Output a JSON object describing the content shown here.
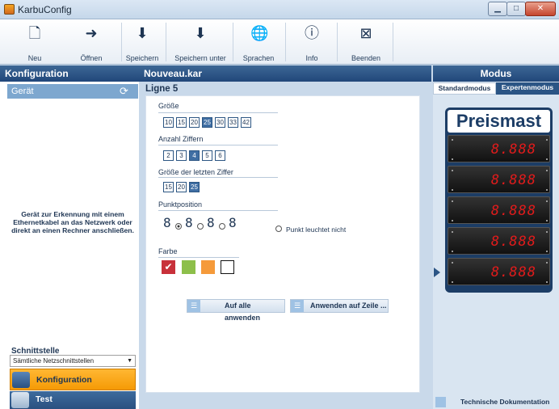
{
  "window": {
    "title": "KarbuConfig",
    "min": "▁",
    "max": "□",
    "close": "✕"
  },
  "toolbar": [
    {
      "label": "Neu",
      "icon": "new-file-icon"
    },
    {
      "label": "Öffnen",
      "icon": "open-file-icon"
    },
    {
      "label": "Speichern",
      "icon": "save-icon"
    },
    {
      "label": "Speichern unter",
      "icon": "save-as-icon"
    },
    {
      "label": "Sprachen",
      "icon": "globe-icon"
    },
    {
      "label": "Info",
      "icon": "info-icon"
    },
    {
      "label": "Beenden",
      "icon": "exit-icon"
    }
  ],
  "sidebar": {
    "title": "Konfiguration",
    "device_label": "Gerät",
    "hint": "Gerät zur Erkennung mit einem Ethernetkabel an das Netzwerk oder direkt an einen Rechner anschließen.",
    "interface_label": "Schnittstelle",
    "interface_value": "Sämtliche Netzschnittstellen",
    "nav": [
      {
        "label": "Konfiguration",
        "active": true
      },
      {
        "label": "Test",
        "active": false
      }
    ]
  },
  "center": {
    "file": "Nouveau.kar",
    "line_title": "Ligne 5",
    "size_label": "Größe",
    "sizes": [
      "10",
      "15",
      "20",
      "25",
      "30",
      "33",
      "42"
    ],
    "size_selected": "25",
    "digits_label": "Anzahl Ziffern",
    "digits": [
      "2",
      "3",
      "4",
      "5",
      "6"
    ],
    "digits_selected": "4",
    "last_digit_label": "Größe der letzten Ziffer",
    "last_digit_sizes": [
      "15",
      "20",
      "25"
    ],
    "last_digit_selected": "25",
    "point_label": "Punktposition",
    "point_digit": "8",
    "point_off_label": "Punkt leuchtet nicht",
    "color_label": "Farbe",
    "colors": [
      "#c8313a",
      "#8dbf4a",
      "#f59a3a",
      "#ffffff"
    ],
    "apply_all": "Auf alle anwenden",
    "apply_line": "Anwenden auf Zeile ..."
  },
  "right": {
    "title": "Modus",
    "tabs": [
      "Standardmodus",
      "Expertenmodus"
    ],
    "active_tab": "Expertenmodus",
    "brand": "Preismast",
    "price_rows": [
      "8.888",
      "8.888",
      "8.888",
      "8.888",
      "8.888"
    ],
    "doc_label": "Technische Dokumentation"
  }
}
